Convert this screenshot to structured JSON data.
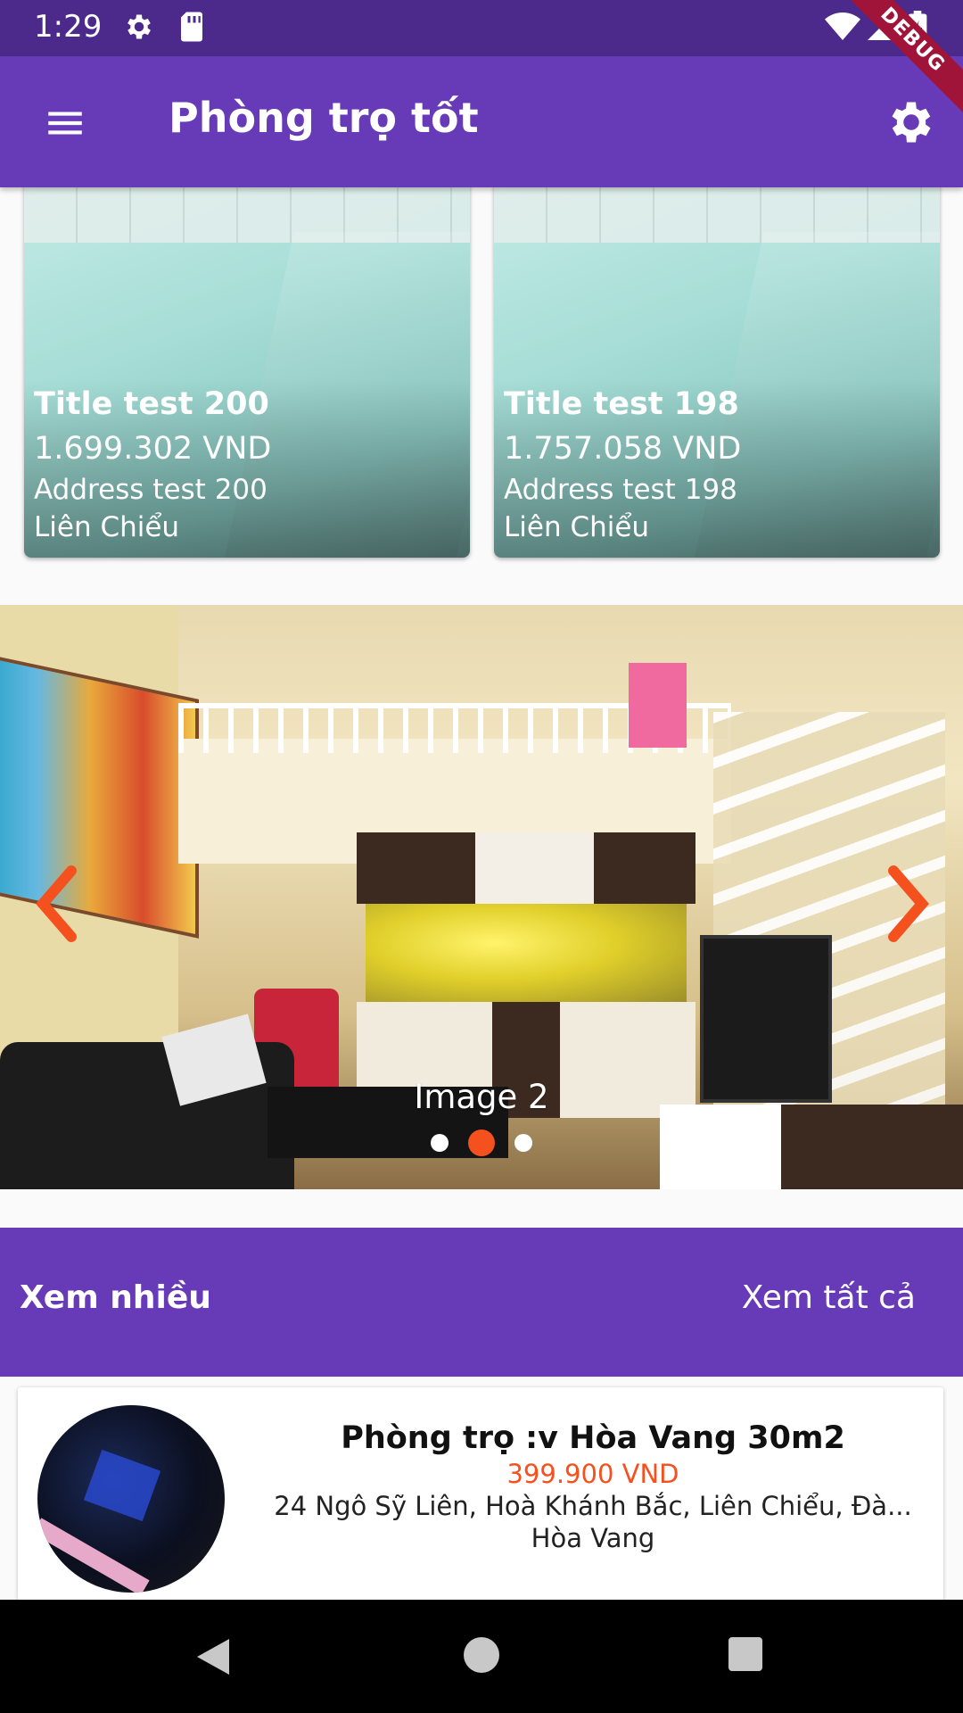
{
  "status_bar": {
    "time": "1:29"
  },
  "debug_label": "DEBUG",
  "app_bar": {
    "title": "Phòng trọ tốt",
    "menu_icon": "menu-icon",
    "settings_icon": "gear-icon"
  },
  "featured": [
    {
      "title": "Title test 200",
      "price": "1.699.302 VND",
      "address": "Address test 200",
      "district": "Liên Chiểu"
    },
    {
      "title": "Title test 198",
      "price": "1.757.058 VND",
      "address": "Address test 198",
      "district": "Liên Chiểu"
    }
  ],
  "carousel": {
    "caption": "Image 2",
    "slide_count": 3,
    "active_index": 1,
    "accent_color": "#f4511e"
  },
  "section": {
    "title": "Xem nhiều",
    "see_all": "Xem tất cả"
  },
  "listings": [
    {
      "name": "Phòng trọ :v Hòa Vang 30m2",
      "price": "399.900 VND",
      "address": "24 Ngô Sỹ Liên, Hoà Khánh Bắc, Liên Chiểu, Đà...",
      "district": "Hòa Vang"
    }
  ],
  "colors": {
    "primary": "#673ab7",
    "status_bar": "#4b2a8c",
    "accent": "#f4511e"
  }
}
